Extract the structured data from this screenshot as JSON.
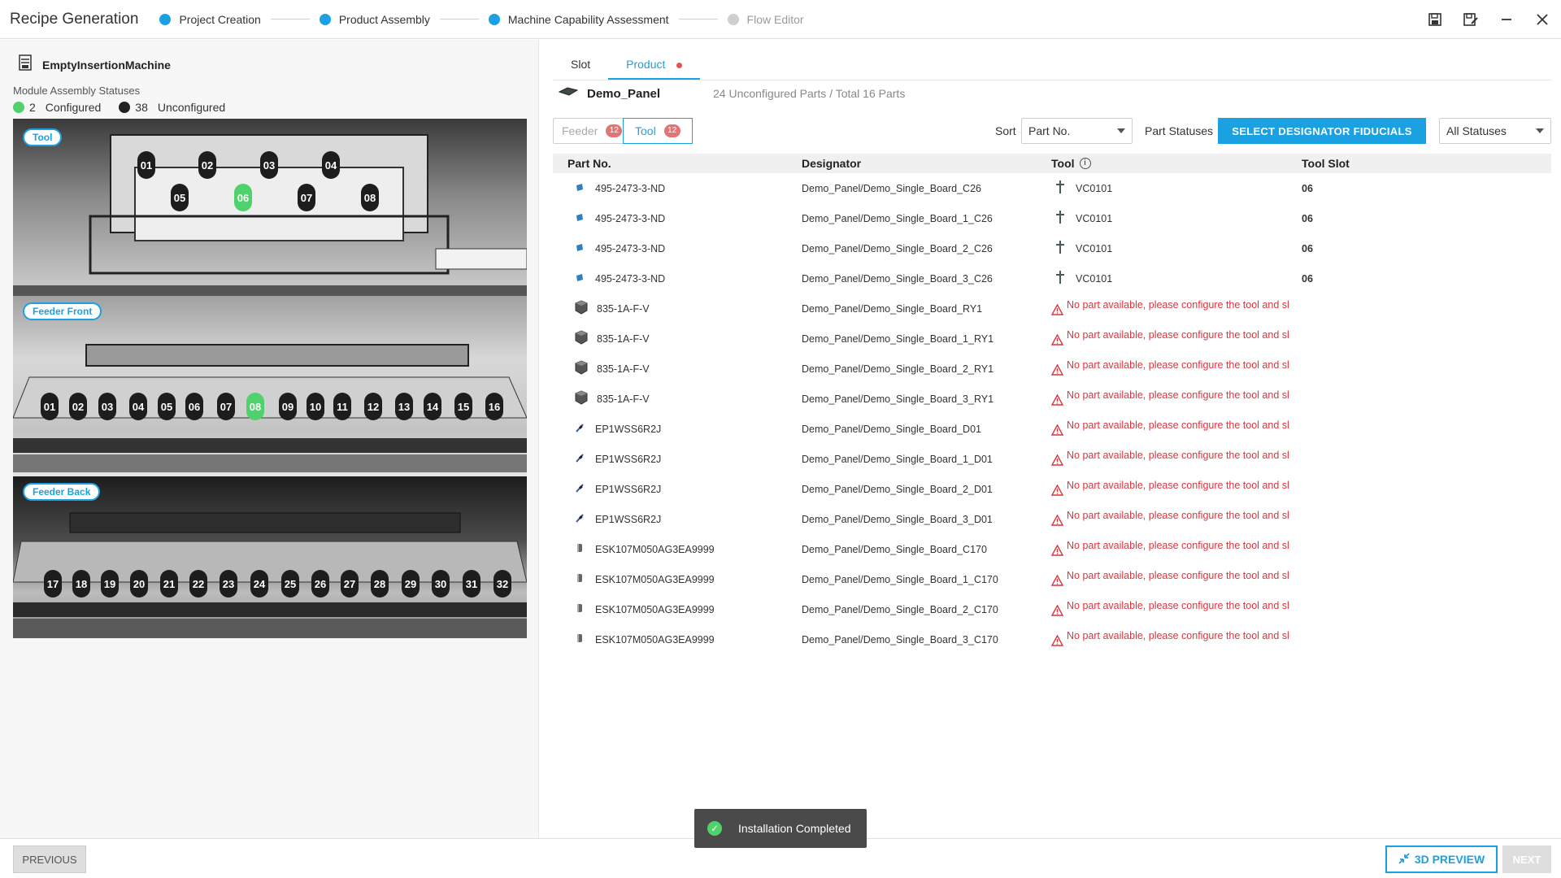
{
  "header": {
    "title": "Recipe Generation",
    "steps": [
      {
        "label": "Project Creation"
      },
      {
        "label": "Product Assembly"
      },
      {
        "label": "Machine Capability Assessment"
      },
      {
        "label": "Flow Editor"
      }
    ]
  },
  "left": {
    "machine_name": "EmptyInsertionMachine",
    "statuses_label": "Module Assembly Statuses",
    "configured_count": "2",
    "configured_label": "Configured",
    "unconfigured_count": "38",
    "unconfigured_label": "Unconfigured",
    "sections": {
      "tool": {
        "label": "Tool",
        "slots_top": [
          "01",
          "02",
          "03",
          "04"
        ],
        "slots_bottom": [
          "05",
          "06",
          "07",
          "08"
        ],
        "active": "06"
      },
      "feeder_front": {
        "label": "Feeder Front",
        "slots": [
          "01",
          "02",
          "03",
          "04",
          "05",
          "06",
          "07",
          "08",
          "09",
          "10",
          "11",
          "12",
          "13",
          "14",
          "15",
          "16"
        ],
        "active": "08"
      },
      "feeder_back": {
        "label": "Feeder Back",
        "slots": [
          "17",
          "18",
          "19",
          "20",
          "21",
          "22",
          "23",
          "24",
          "25",
          "26",
          "27",
          "28",
          "29",
          "30",
          "31",
          "32"
        ]
      }
    }
  },
  "right": {
    "tabs": [
      {
        "label": "Slot"
      },
      {
        "label": "Product"
      }
    ],
    "panel_name": "Demo_Panel",
    "summary": "24 Unconfigured Parts / Total 16 Parts",
    "feeder_label": "Feeder",
    "feeder_count": "12",
    "tool_label": "Tool",
    "tool_count": "12",
    "sort_label": "Sort",
    "sort_value": "Part No.",
    "part_statuses_label": "Part Statuses",
    "fiducials_button": "SELECT DESIGNATOR  FIDUCIALS",
    "status_filter": "All Statuses",
    "columns": {
      "part": "Part No.",
      "designator": "Designator",
      "tool": "Tool",
      "slot": "Tool Slot"
    },
    "warning_text": "No part available, please configure the tool and sl",
    "rows": [
      {
        "part": "495-2473-3-ND",
        "designator": "Demo_Panel/Demo_Single_Board_C26",
        "tool": "VC0101",
        "slot": "06",
        "kind": "cap-blue"
      },
      {
        "part": "495-2473-3-ND",
        "designator": "Demo_Panel/Demo_Single_Board_1_C26",
        "tool": "VC0101",
        "slot": "06",
        "kind": "cap-blue"
      },
      {
        "part": "495-2473-3-ND",
        "designator": "Demo_Panel/Demo_Single_Board_2_C26",
        "tool": "VC0101",
        "slot": "06",
        "kind": "cap-blue"
      },
      {
        "part": "495-2473-3-ND",
        "designator": "Demo_Panel/Demo_Single_Board_3_C26",
        "tool": "VC0101",
        "slot": "06",
        "kind": "cap-blue"
      },
      {
        "part": "835-1A-F-V",
        "designator": "Demo_Panel/Demo_Single_Board_RY1",
        "kind": "relay"
      },
      {
        "part": "835-1A-F-V",
        "designator": "Demo_Panel/Demo_Single_Board_1_RY1",
        "kind": "relay"
      },
      {
        "part": "835-1A-F-V",
        "designator": "Demo_Panel/Demo_Single_Board_2_RY1",
        "kind": "relay"
      },
      {
        "part": "835-1A-F-V",
        "designator": "Demo_Panel/Demo_Single_Board_3_RY1",
        "kind": "relay"
      },
      {
        "part": "EP1WSS6R2J",
        "designator": "Demo_Panel/Demo_Single_Board_D01",
        "kind": "diode"
      },
      {
        "part": "EP1WSS6R2J",
        "designator": "Demo_Panel/Demo_Single_Board_1_D01",
        "kind": "diode"
      },
      {
        "part": "EP1WSS6R2J",
        "designator": "Demo_Panel/Demo_Single_Board_2_D01",
        "kind": "diode"
      },
      {
        "part": "EP1WSS6R2J",
        "designator": "Demo_Panel/Demo_Single_Board_3_D01",
        "kind": "diode"
      },
      {
        "part": "ESK107M050AG3EA9999",
        "designator": "Demo_Panel/Demo_Single_Board_C170",
        "kind": "elcap"
      },
      {
        "part": "ESK107M050AG3EA9999",
        "designator": "Demo_Panel/Demo_Single_Board_1_C170",
        "kind": "elcap"
      },
      {
        "part": "ESK107M050AG3EA9999",
        "designator": "Demo_Panel/Demo_Single_Board_2_C170",
        "kind": "elcap"
      },
      {
        "part": "ESK107M050AG3EA9999",
        "designator": "Demo_Panel/Demo_Single_Board_3_C170",
        "kind": "elcap"
      }
    ]
  },
  "bottom": {
    "previous": "PREVIOUS",
    "preview": "3D PREVIEW",
    "next": "NEXT",
    "toast": "Installation Completed"
  },
  "colors": {
    "accent": "#1ba1e2",
    "configured": "#4fd16b",
    "warning": "#d9363e"
  }
}
